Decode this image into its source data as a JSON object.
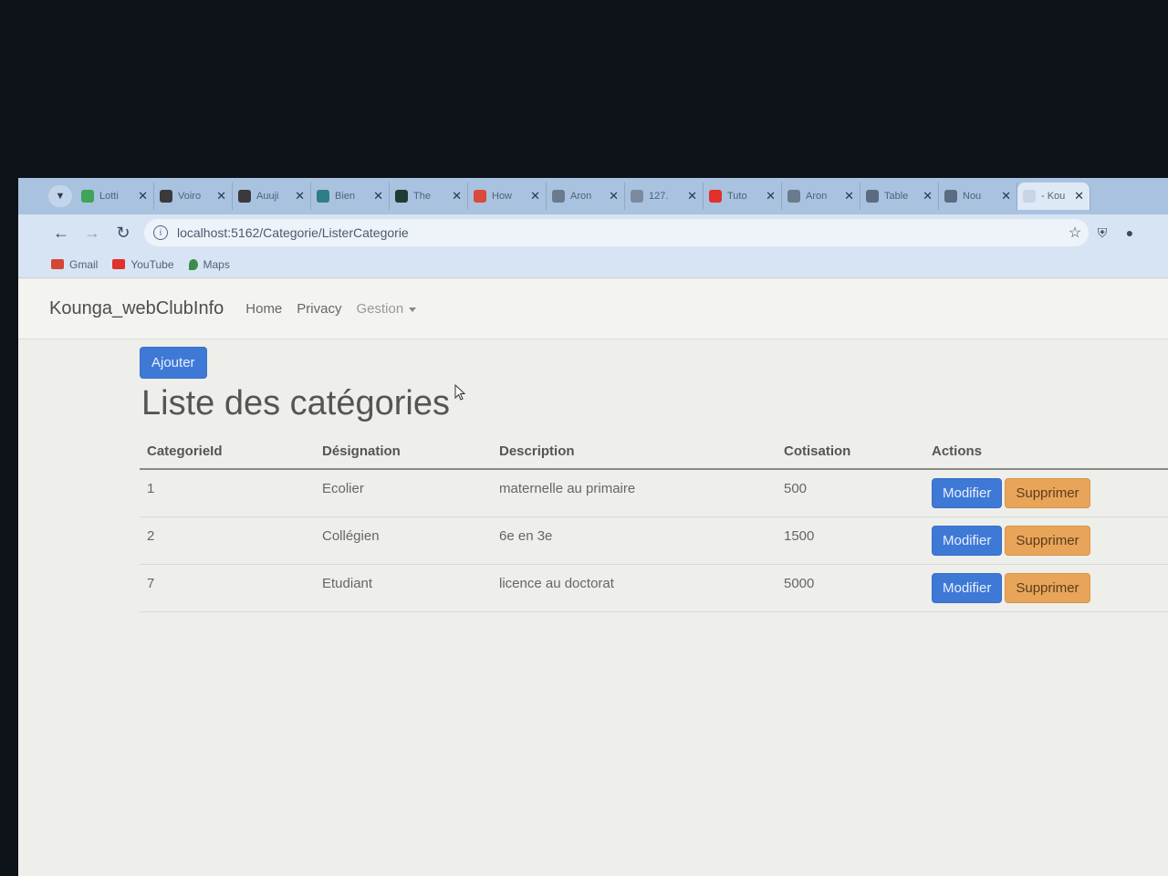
{
  "browser": {
    "tabs": [
      {
        "label": "Lotti",
        "color": "#3fa35a"
      },
      {
        "label": "Voiro",
        "color": "#3a3a3a"
      },
      {
        "label": "Auuji",
        "color": "#3a3a3a"
      },
      {
        "label": "Bien",
        "color": "#2f7e86"
      },
      {
        "label": "The",
        "color": "#1f3b34"
      },
      {
        "label": "How",
        "color": "#d94a3a"
      },
      {
        "label": "Aron",
        "color": "#6b7a8c"
      },
      {
        "label": "127.",
        "color": "#7c8aa0"
      },
      {
        "label": "Tuto",
        "color": "#e0312b"
      },
      {
        "label": "Aron",
        "color": "#6b7a8c"
      },
      {
        "label": "Table",
        "color": "#5b6b80"
      },
      {
        "label": "Nou",
        "color": "#5b6b80"
      },
      {
        "label": "- Kou",
        "color": "#c9d5e4"
      }
    ],
    "url": "localhost:5162/Categorie/ListerCategorie",
    "bookmarks": [
      {
        "label": "Gmail",
        "color": "#d44638"
      },
      {
        "label": "YouTube",
        "color": "#e0312b"
      },
      {
        "label": "Maps",
        "color": "#3b8c4a"
      }
    ]
  },
  "navbar": {
    "brand": "Kounga_webClubInfo",
    "home": "Home",
    "privacy": "Privacy",
    "gestion": "Gestion"
  },
  "page": {
    "add_button": "Ajouter",
    "title": "Liste des catégories",
    "columns": [
      "CategorieId",
      "Désignation",
      "Description",
      "Cotisation",
      "Actions"
    ],
    "rows": [
      {
        "id": "1",
        "designation": "Ecolier",
        "description": "maternelle au primaire",
        "cotisation": "500"
      },
      {
        "id": "2",
        "designation": "Collégien",
        "description": "6e en 3e",
        "cotisation": "1500"
      },
      {
        "id": "7",
        "designation": "Etudiant",
        "description": "licence au doctorat",
        "cotisation": "5000"
      }
    ],
    "edit_label": "Modifier",
    "delete_label": "Supprimer"
  }
}
